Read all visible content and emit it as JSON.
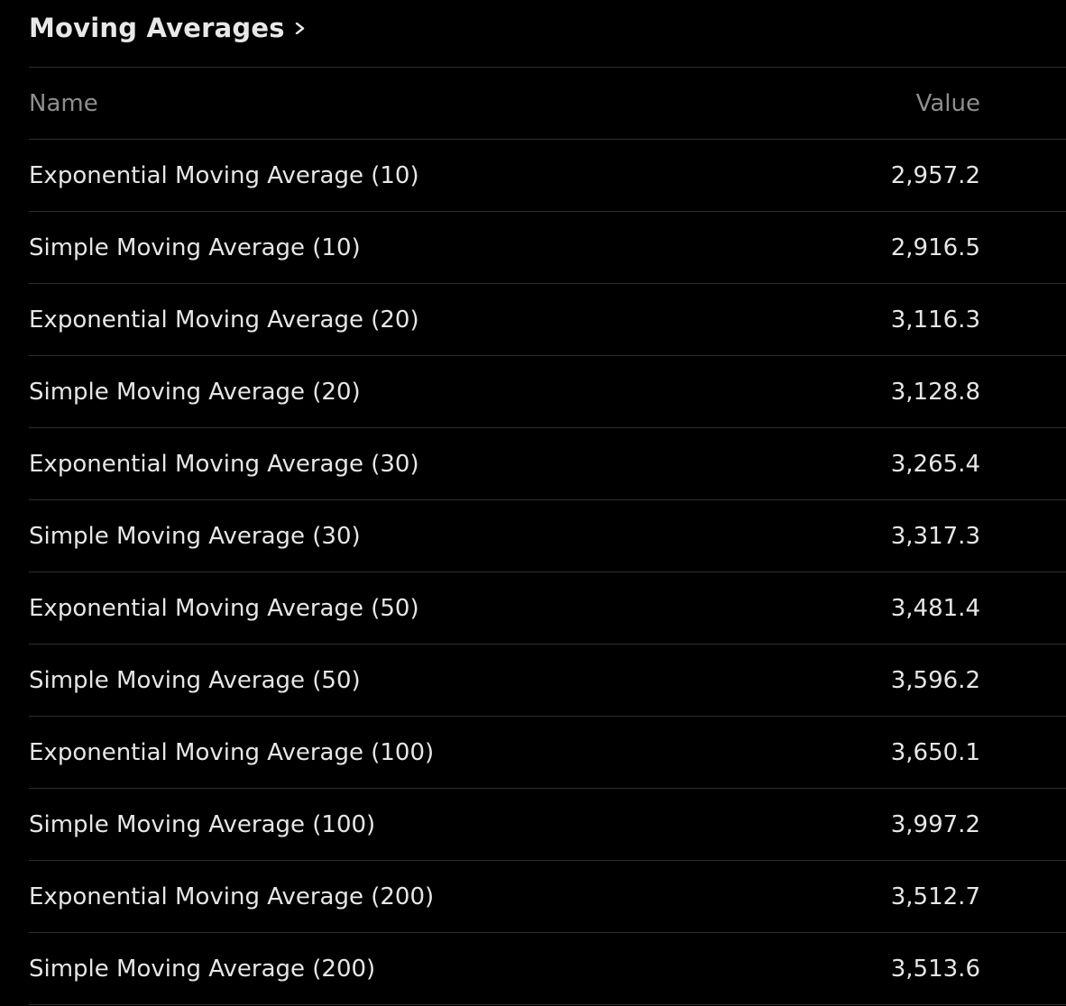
{
  "header": {
    "title": "Moving Averages",
    "chevron_icon": "chevron-right-icon"
  },
  "table": {
    "columns": {
      "name": "Name",
      "value": "Value"
    },
    "rows": [
      {
        "name": "Exponential Moving Average (10)",
        "value": "2,957.2"
      },
      {
        "name": "Simple Moving Average (10)",
        "value": "2,916.5"
      },
      {
        "name": "Exponential Moving Average (20)",
        "value": "3,116.3"
      },
      {
        "name": "Simple Moving Average (20)",
        "value": "3,128.8"
      },
      {
        "name": "Exponential Moving Average (30)",
        "value": "3,265.4"
      },
      {
        "name": "Simple Moving Average (30)",
        "value": "3,317.3"
      },
      {
        "name": "Exponential Moving Average (50)",
        "value": "3,481.4"
      },
      {
        "name": "Simple Moving Average (50)",
        "value": "3,596.2"
      },
      {
        "name": "Exponential Moving Average (100)",
        "value": "3,650.1"
      },
      {
        "name": "Simple Moving Average (100)",
        "value": "3,997.2"
      },
      {
        "name": "Exponential Moving Average (200)",
        "value": "3,512.7"
      },
      {
        "name": "Simple Moving Average (200)",
        "value": "3,513.6"
      }
    ]
  },
  "colors": {
    "background": "#000000",
    "text": "#e6e6e6",
    "muted_text": "#8e8e8e",
    "divider": "#2d2d2d"
  }
}
